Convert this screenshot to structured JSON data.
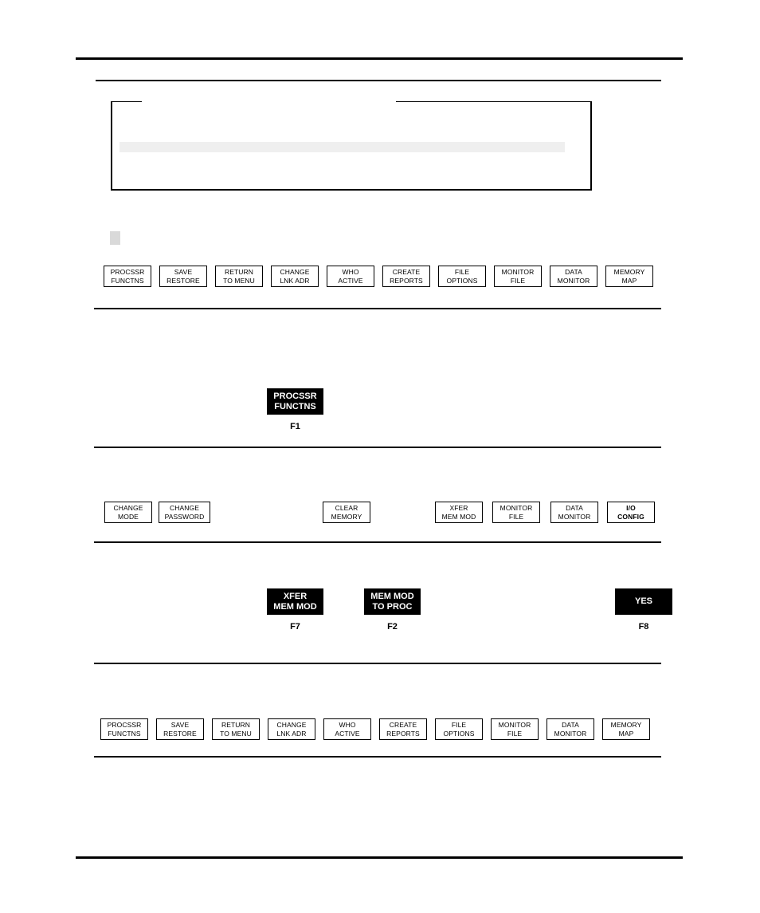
{
  "page": {
    "background": "#ffffff",
    "ink": "#000000",
    "highlight_fill": "#efefef",
    "chip_fill": "#d9d9d9"
  },
  "framed_block": {
    "name": "empty-framed-text-region",
    "highlight_bar": ""
  },
  "softkey_rows": [
    {
      "id": "row-menu-top",
      "keys": [
        {
          "line1": "PROCSSR",
          "line2": "FUNCTNS",
          "bold": false
        },
        {
          "line1": "SAVE",
          "line2": "RESTORE",
          "bold": false
        },
        {
          "line1": "RETURN",
          "line2": "TO MENU",
          "bold": false
        },
        {
          "line1": "CHANGE",
          "line2": "LNK ADR",
          "bold": false
        },
        {
          "line1": "WHO",
          "line2": "ACTIVE",
          "bold": false
        },
        {
          "line1": "CREATE",
          "line2": "REPORTS",
          "bold": false
        },
        {
          "line1": "FILE",
          "line2": "OPTIONS",
          "bold": false
        },
        {
          "line1": "MONITOR",
          "line2": "FILE",
          "bold": false
        },
        {
          "line1": "DATA",
          "line2": "MONITOR",
          "bold": false
        },
        {
          "line1": "MEMORY",
          "line2": "MAP",
          "bold": false
        }
      ]
    },
    {
      "id": "row-processor-functions",
      "keys": [
        {
          "line1": "CHANGE",
          "line2": "MODE",
          "bold": false
        },
        {
          "line1": "CHANGE",
          "line2": "PASSWORD",
          "bold": false
        },
        {
          "line1": "CLEAR",
          "line2": "MEMORY",
          "bold": false
        },
        {
          "line1": "XFER",
          "line2": "MEM MOD",
          "bold": false
        },
        {
          "line1": "MONITOR",
          "line2": "FILE",
          "bold": false
        },
        {
          "line1": "DATA",
          "line2": "MONITOR",
          "bold": false
        },
        {
          "line1": "I/O",
          "line2": "CONFIG",
          "bold": true
        }
      ]
    },
    {
      "id": "row-menu-bottom",
      "keys": [
        {
          "line1": "PROCSSR",
          "line2": "FUNCTNS",
          "bold": false
        },
        {
          "line1": "SAVE",
          "line2": "RESTORE",
          "bold": false
        },
        {
          "line1": "RETURN",
          "line2": "TO MENU",
          "bold": false
        },
        {
          "line1": "CHANGE",
          "line2": "LNK ADR",
          "bold": false
        },
        {
          "line1": "WHO",
          "line2": "ACTIVE",
          "bold": false
        },
        {
          "line1": "CREATE",
          "line2": "REPORTS",
          "bold": false
        },
        {
          "line1": "FILE",
          "line2": "OPTIONS",
          "bold": false
        },
        {
          "line1": "MONITOR",
          "line2": "FILE",
          "bold": false
        },
        {
          "line1": "DATA",
          "line2": "MONITOR",
          "bold": false
        },
        {
          "line1": "MEMORY",
          "line2": "MAP",
          "bold": false
        }
      ]
    }
  ],
  "selected_keys": [
    {
      "id": "procssr-functns",
      "line1": "PROCSSR",
      "line2": "FUNCTNS",
      "fkey": "F1"
    },
    {
      "id": "xfer-mem-mod",
      "line1": "XFER",
      "line2": "MEM MOD",
      "fkey": "F7"
    },
    {
      "id": "mem-mod-to-proc",
      "line1": "MEM MOD",
      "line2": "TO PROC",
      "fkey": "F2"
    },
    {
      "id": "yes",
      "line1": "YES",
      "line2": "",
      "fkey": "F8"
    }
  ]
}
